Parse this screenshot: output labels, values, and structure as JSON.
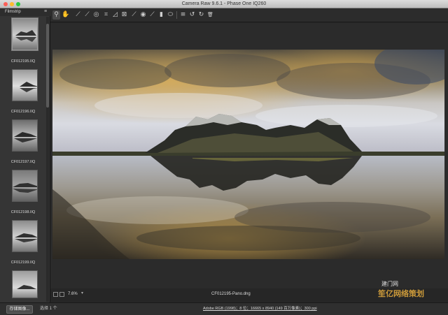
{
  "window": {
    "title": "Camera Raw 9.6.1 - Phase One IQ260",
    "traffic_colors": [
      "#fc5f57",
      "#fdbc2e",
      "#28c840"
    ]
  },
  "toolbar": {
    "tools": [
      {
        "icon": "zoom-icon",
        "glyph": "⚲"
      },
      {
        "icon": "hand-icon",
        "glyph": "✋"
      },
      {
        "icon": "white-balance-icon",
        "glyph": "⟋"
      },
      {
        "icon": "color-sampler-icon",
        "glyph": "⟋"
      },
      {
        "icon": "target-adjust-icon",
        "glyph": "◎"
      },
      {
        "icon": "crop-icon",
        "glyph": "⌗"
      },
      {
        "icon": "straighten-icon",
        "glyph": "◿"
      },
      {
        "icon": "transform-icon",
        "glyph": "⊠"
      },
      {
        "icon": "spot-removal-icon",
        "glyph": "⟋"
      },
      {
        "icon": "red-eye-icon",
        "glyph": "◉"
      },
      {
        "icon": "adjustment-brush-icon",
        "glyph": "⟋"
      },
      {
        "icon": "graduated-filter-icon",
        "glyph": "▮"
      },
      {
        "icon": "radial-filter-icon",
        "glyph": "⬭"
      },
      {
        "icon": "preferences-icon",
        "glyph": "≡"
      },
      {
        "icon": "rotate-ccw-icon",
        "glyph": "↺"
      },
      {
        "icon": "rotate-cw-icon",
        "glyph": "↻"
      },
      {
        "icon": "trash-icon",
        "glyph": "🗑"
      }
    ]
  },
  "filmstrip": {
    "title": "Filmstrip",
    "menu_glyph": "≡",
    "items": [
      {
        "label": "CF012195.IIQ",
        "selected": true
      },
      {
        "label": "CF012196.IIQ",
        "selected": false
      },
      {
        "label": "CF012197.IIQ",
        "selected": false
      },
      {
        "label": "CF012198.IIQ",
        "selected": false
      },
      {
        "label": "CF012199.IIQ",
        "selected": false
      },
      {
        "label": "",
        "selected": false
      }
    ]
  },
  "status": {
    "zoom": "7.6%",
    "zoom_caret": "▾",
    "filename": "CF012195-Pano.dng"
  },
  "footer": {
    "save_label": "存储图像...",
    "selection_count": "选择 1 个",
    "workflow": "Adobe RGB (1998)；8 位；16665 x 8940 (149 百万像素)；300 ppi"
  },
  "watermark": {
    "line1": "建门网",
    "line2": "笙亿网络策划"
  }
}
